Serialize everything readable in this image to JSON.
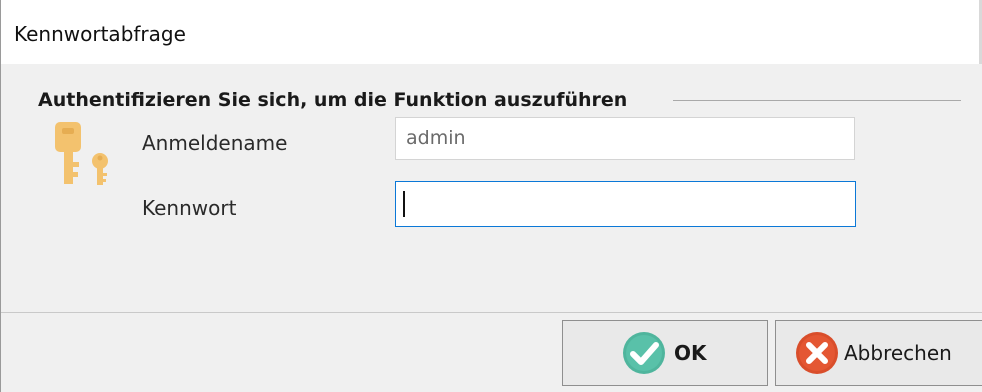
{
  "window": {
    "title": "Kennwortabfrage"
  },
  "group": {
    "heading": "Authentifizieren Sie sich, um die Funktion auszuführen"
  },
  "form": {
    "username_label": "Anmeldename",
    "username_value": "admin",
    "password_label": "Kennwort",
    "password_value": ""
  },
  "buttons": {
    "ok_label": "OK",
    "cancel_label": "Abbrechen"
  },
  "icons": {
    "key": "key-icon",
    "ok": "check-circle-icon",
    "cancel": "x-circle-icon"
  },
  "colors": {
    "accent": "#0b78d7",
    "ok_icon": "#4fb59d",
    "cancel_icon": "#e45733",
    "key": "#f3c26e"
  }
}
